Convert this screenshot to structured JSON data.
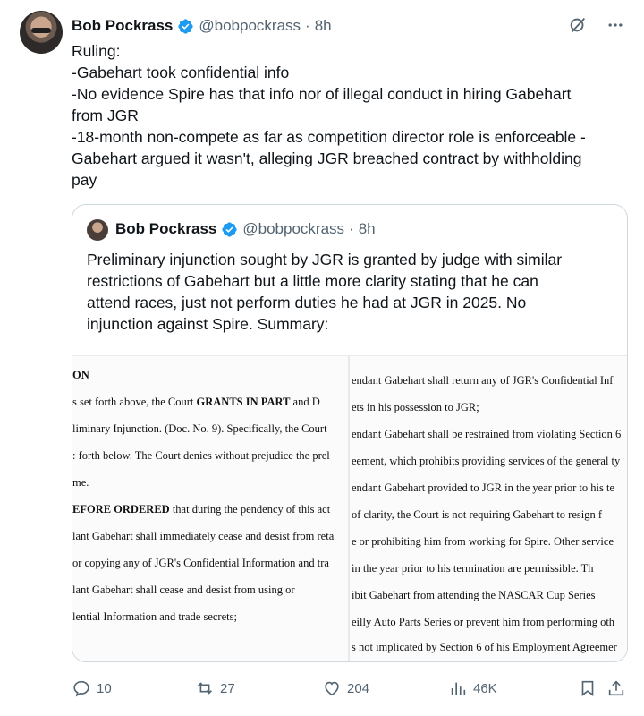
{
  "author": {
    "name": "Bob Pockrass",
    "handle": "@bobpockrass",
    "separator": "·",
    "time": "8h"
  },
  "icons": {
    "verified": "verified-badge-icon",
    "grok": "grok-icon",
    "more": "more-icon",
    "reply": "reply-icon",
    "retweet": "retweet-icon",
    "like": "heart-icon",
    "views": "views-icon",
    "bookmark": "bookmark-icon",
    "share": "share-icon"
  },
  "colors": {
    "verified": "#1d9bf0",
    "text": "#0f1419",
    "secondary": "#536471",
    "border": "#cfd9de"
  },
  "tweet": {
    "lines": [
      "Ruling:",
      "-Gabehart took confidential info",
      "-No evidence Spire has that info nor of illegal conduct in hiring Gabehart",
      "from JGR",
      "-18-month non-compete as far as competition director role is enforceable -",
      "Gabehart argued it wasn't, alleging JGR breached contract by withholding",
      "pay"
    ]
  },
  "quote": {
    "name": "Bob Pockrass",
    "handle": "@bobpockrass",
    "separator": "·",
    "time": "8h",
    "lines": [
      "Preliminary injunction sought by JGR is granted by judge with similar",
      "restrictions of Gabehart but a little more clarity stating that he can",
      "attend races, just not perform duties he had at JGR in 2025. No",
      "injunction against Spire. Summary:"
    ],
    "document": {
      "left": [
        {
          "pre": "ON",
          "bold": "",
          "post": ""
        },
        {
          "pre": "s set forth above, the Court ",
          "bold": "GRANTS IN PART",
          "post": " and D"
        },
        {
          "pre": "liminary Injunction. (Doc. No. 9). Specifically, the Court",
          "bold": "",
          "post": ""
        },
        {
          "pre": ": forth below. The Court denies without prejudice the prel",
          "bold": "",
          "post": ""
        },
        {
          "pre": "me.",
          "bold": "",
          "post": ""
        },
        {
          "pre": "",
          "bold": "EFORE ORDERED",
          "post": " that during the pendency of this act"
        },
        {
          "pre": "lant Gabehart shall immediately cease and desist from reta",
          "bold": "",
          "post": ""
        },
        {
          "pre": "or copying any of JGR's Confidential Information and tra",
          "bold": "",
          "post": ""
        },
        {
          "pre": "lant Gabehart shall cease and desist from using or",
          "bold": "",
          "post": ""
        },
        {
          "pre": "lential Information and trade secrets;",
          "bold": "",
          "post": ""
        }
      ],
      "right": [
        "endant Gabehart shall return any of JGR's Confidential Inf",
        "ets in his possession to JGR;",
        "endant Gabehart shall be restrained from violating Section 6",
        "eement, which prohibits providing services of the general ty",
        "endant Gabehart provided to JGR in the year prior to his te",
        "of clarity, the Court is not requiring Gabehart to resign f",
        "e or prohibiting him from working for Spire. Other service",
        "in the year prior to his termination are permissible. Th",
        "ibit Gabehart from attending the NASCAR Cup Series",
        "eilly Auto Parts Series or prevent him from performing oth",
        "s not implicated by Section 6 of his Employment Agreemer"
      ]
    }
  },
  "stats": {
    "replies": "10",
    "retweets": "27",
    "likes": "204",
    "views": "46K"
  }
}
